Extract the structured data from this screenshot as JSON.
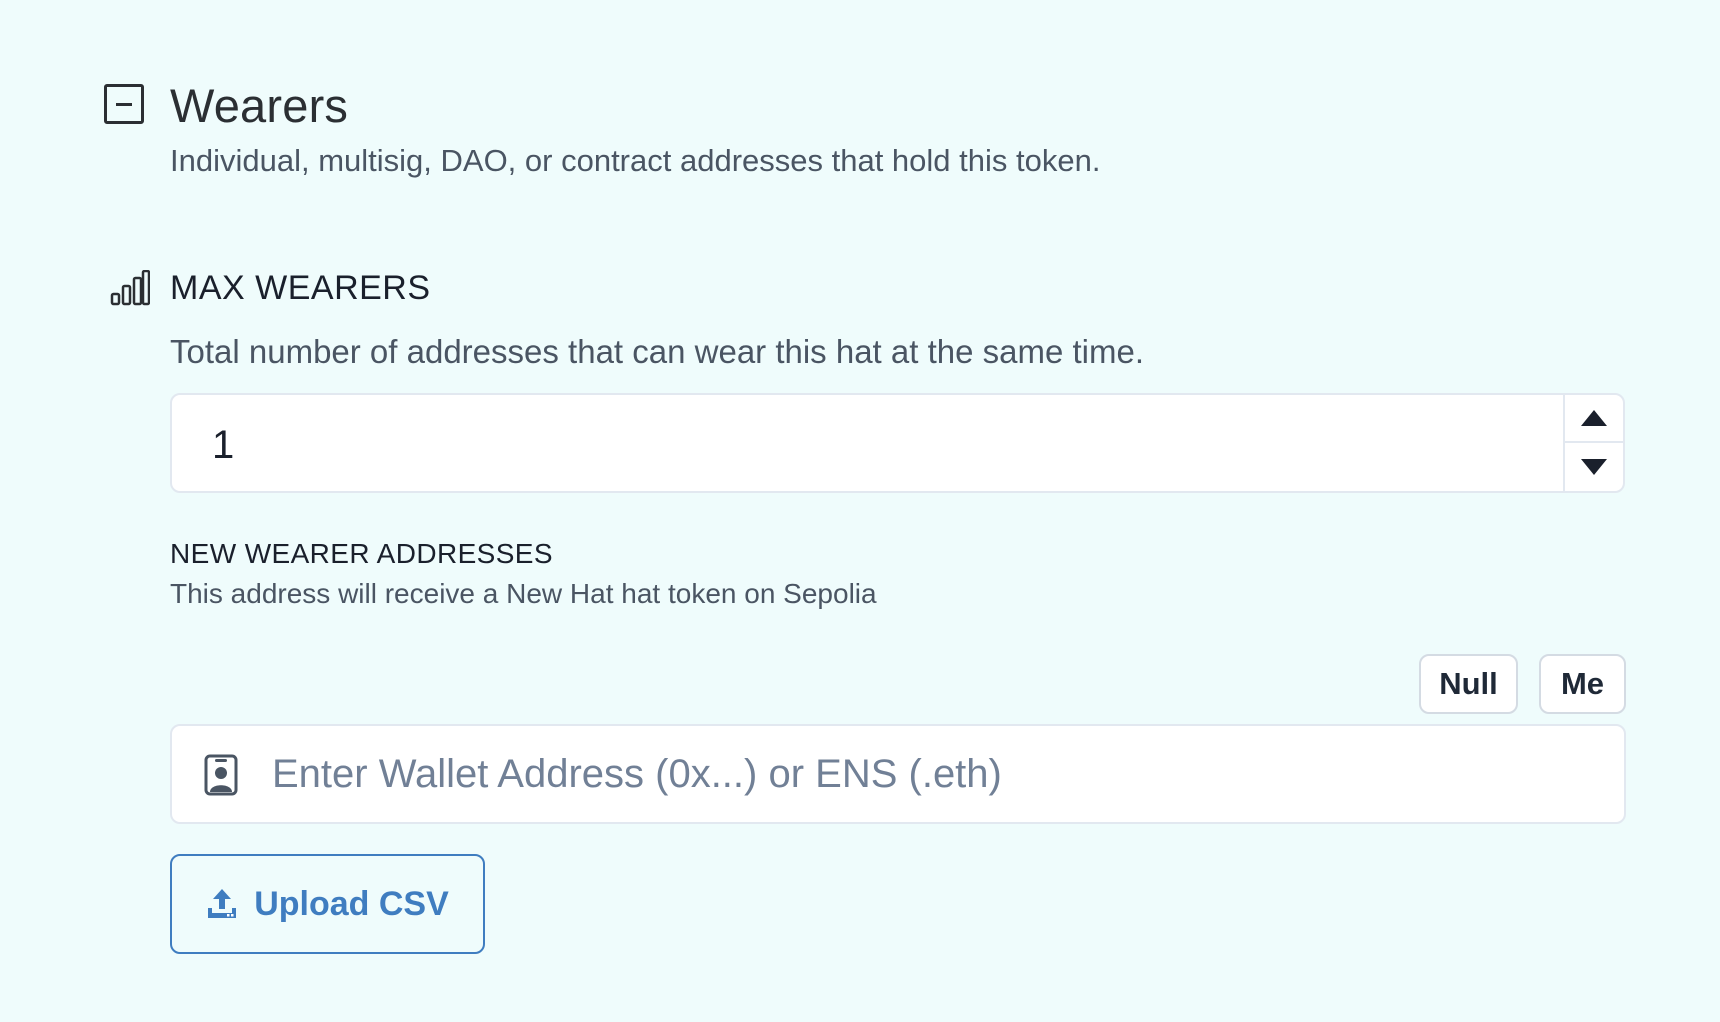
{
  "section": {
    "title": "Wearers",
    "description": "Individual, multisig, DAO, or contract addresses that hold this token.",
    "icon": "minus-square-icon"
  },
  "max_wearers": {
    "title": "MAX WEARERS",
    "description": "Total number of addresses that can wear this hat at the same time.",
    "value": "1",
    "icon": "bar-chart-icon"
  },
  "new_wearers": {
    "title": "NEW WEARER ADDRESSES",
    "description": "This address will receive a New Hat hat token on Sepolia",
    "null_label": "Null",
    "me_label": "Me",
    "address_placeholder": "Enter Wallet Address (0x...) or ENS (.eth)",
    "upload_label": "Upload CSV"
  },
  "colors": {
    "background": "#effcfc",
    "accent": "#3f7dc0",
    "border": "#e2e8f0"
  }
}
